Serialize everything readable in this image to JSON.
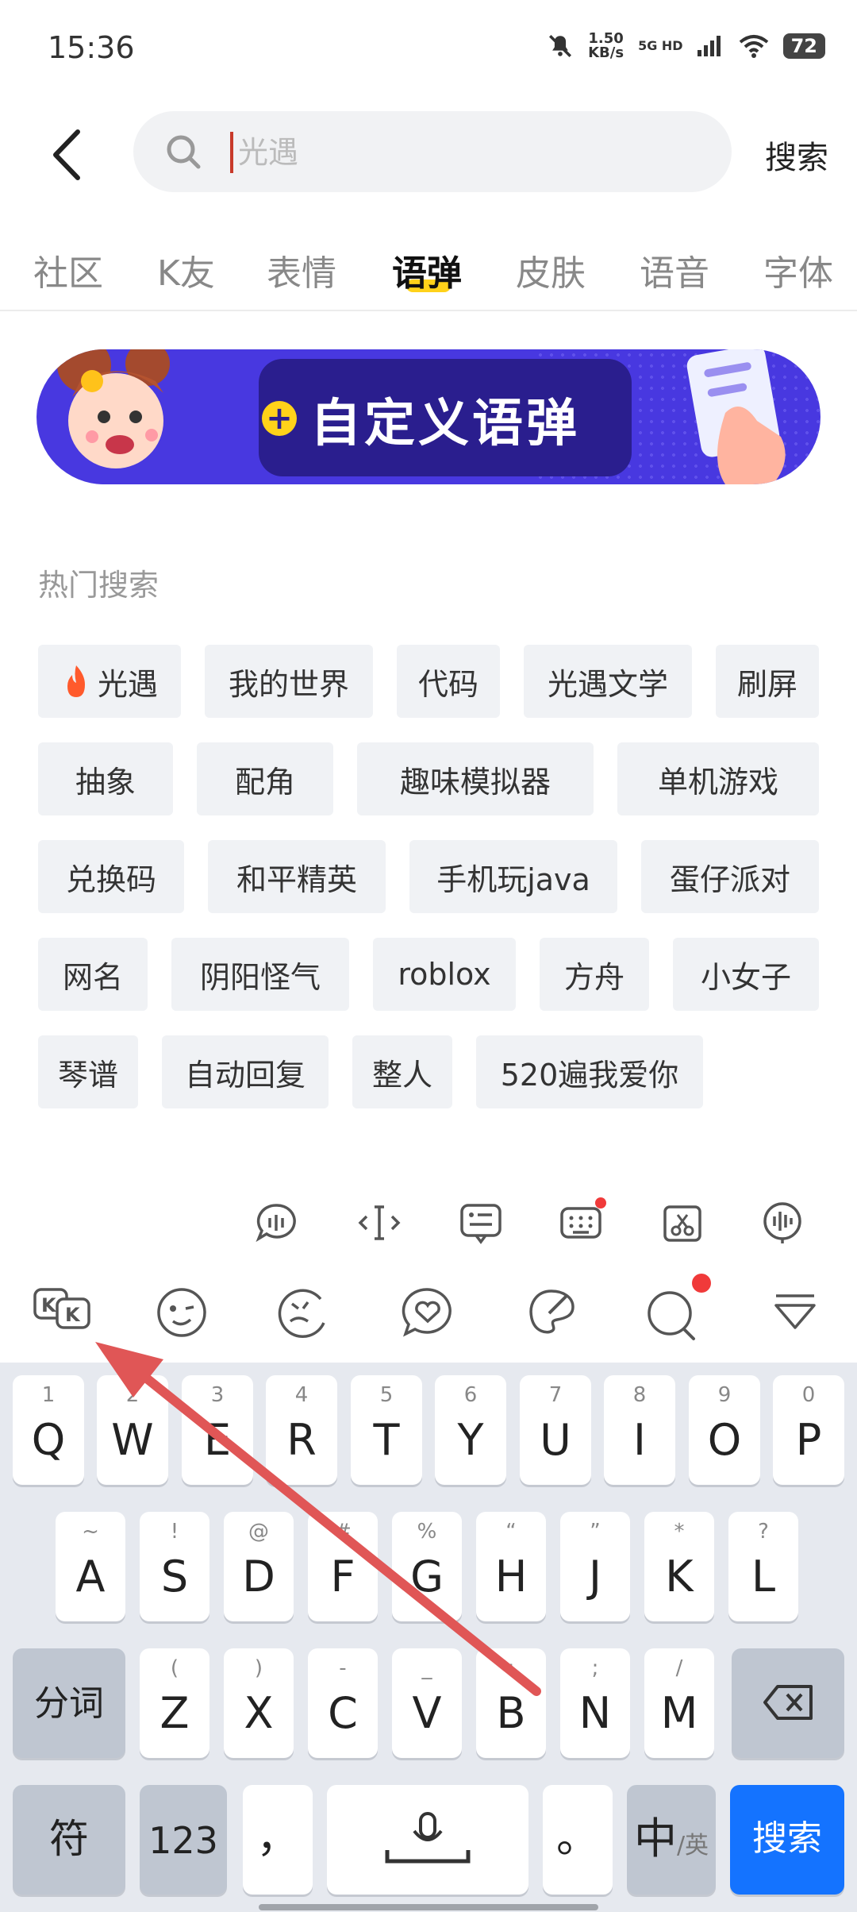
{
  "status_bar": {
    "time": "15:36",
    "speed_value": "1.50",
    "speed_unit": "KB/s",
    "network": "5G HD",
    "battery": "72"
  },
  "search": {
    "placeholder": "光遇",
    "button": "搜索"
  },
  "tabs": [
    {
      "label": "社区"
    },
    {
      "label": "K友"
    },
    {
      "label": "表情"
    },
    {
      "label": "语弹"
    },
    {
      "label": "皮肤"
    },
    {
      "label": "语音"
    },
    {
      "label": "字体"
    }
  ],
  "active_tab": "语弹",
  "banner": {
    "text": "自定义语弹",
    "plus": "+"
  },
  "hot_search": {
    "title": "热门搜索",
    "tags": [
      "光遇",
      "我的世界",
      "代码",
      "光遇文学",
      "刷屏",
      "抽象",
      "配角",
      "趣味模拟器",
      "单机游戏",
      "兑换码",
      "和平精英",
      "手机玩java",
      "蛋仔派对",
      "网名",
      "阴阳怪气",
      "roblox",
      "方舟",
      "小女子",
      "琴谱",
      "自动回复",
      "整人",
      "520遍我爱你"
    ]
  },
  "keyboard": {
    "row1": [
      {
        "k": "Q",
        "s": "1"
      },
      {
        "k": "W",
        "s": "2"
      },
      {
        "k": "E",
        "s": "3"
      },
      {
        "k": "R",
        "s": "4"
      },
      {
        "k": "T",
        "s": "5"
      },
      {
        "k": "Y",
        "s": "6"
      },
      {
        "k": "U",
        "s": "7"
      },
      {
        "k": "I",
        "s": "8"
      },
      {
        "k": "O",
        "s": "9"
      },
      {
        "k": "P",
        "s": "0"
      }
    ],
    "row2": [
      {
        "k": "A",
        "s": "~"
      },
      {
        "k": "S",
        "s": "!"
      },
      {
        "k": "D",
        "s": "@"
      },
      {
        "k": "F",
        "s": "#"
      },
      {
        "k": "G",
        "s": "%"
      },
      {
        "k": "H",
        "s": "“"
      },
      {
        "k": "J",
        "s": "”"
      },
      {
        "k": "K",
        "s": "*"
      },
      {
        "k": "L",
        "s": "?"
      }
    ],
    "row3": [
      {
        "k": "Z",
        "s": "("
      },
      {
        "k": "X",
        "s": ")"
      },
      {
        "k": "C",
        "s": "-"
      },
      {
        "k": "V",
        "s": "_"
      },
      {
        "k": "B",
        "s": ":"
      },
      {
        "k": "N",
        "s": ";"
      },
      {
        "k": "M",
        "s": "/"
      }
    ],
    "segment": "分词",
    "symbols": "符",
    "numbers": "123",
    "comma": "，",
    "period": "。",
    "lang_main": "中",
    "lang_sub": "/英",
    "enter": "搜索"
  },
  "colors": {
    "accent_yellow": "#ffd21a",
    "banner_blue": "#4838e0",
    "enter_blue": "#1473ff",
    "arrow_red": "#e05656"
  }
}
